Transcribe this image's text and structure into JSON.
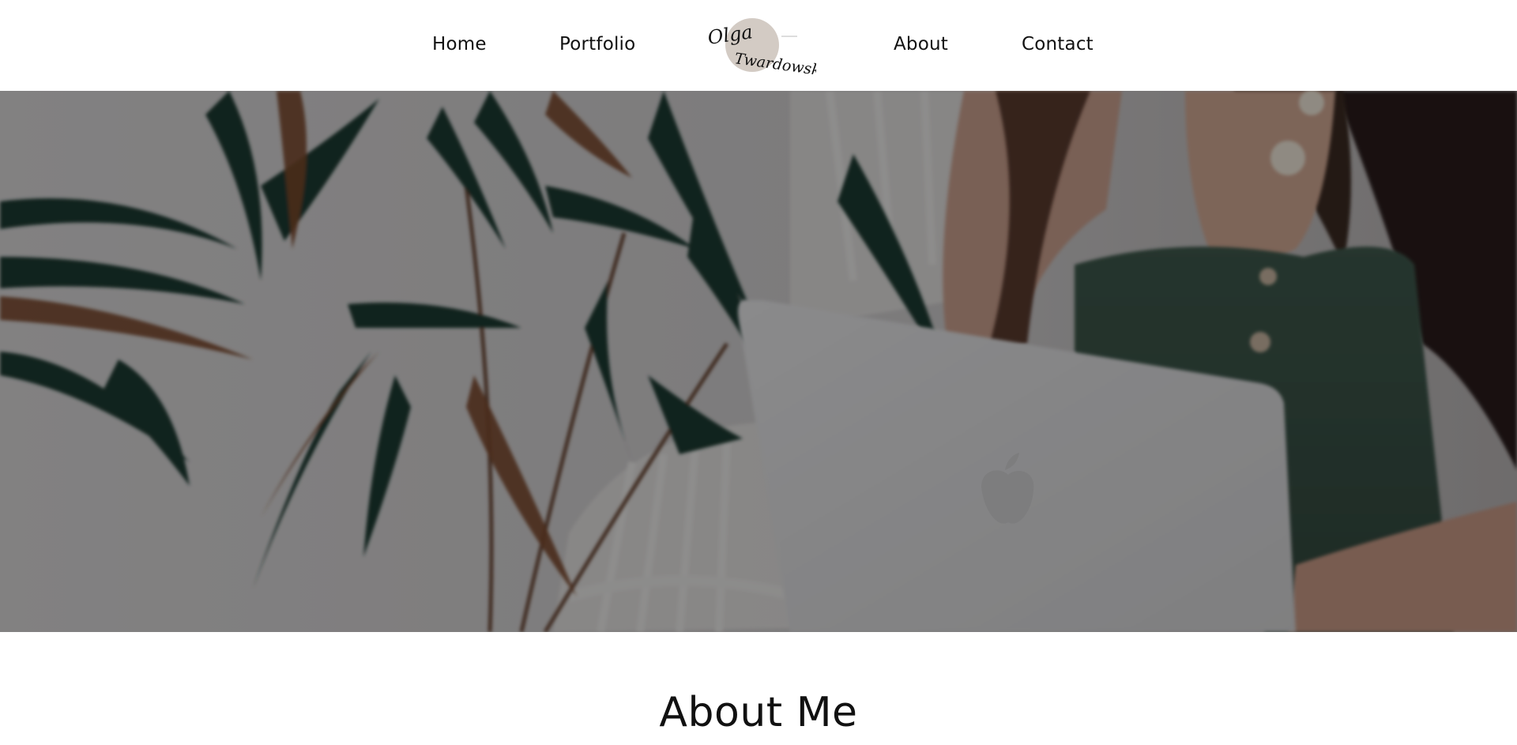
{
  "nav": {
    "items": [
      {
        "label": "Home"
      },
      {
        "label": "Portfolio"
      },
      {
        "label": "About"
      },
      {
        "label": "Contact"
      }
    ],
    "logo": {
      "line1": "Olga",
      "line2": "Twardowska",
      "circle_color": "#d3cbc4"
    }
  },
  "hero": {
    "image_icon": "woman-with-laptop-and-plant-photo",
    "overlay_color": "#000000",
    "overlay_opacity": 0.4
  },
  "about": {
    "title": "About Me"
  }
}
